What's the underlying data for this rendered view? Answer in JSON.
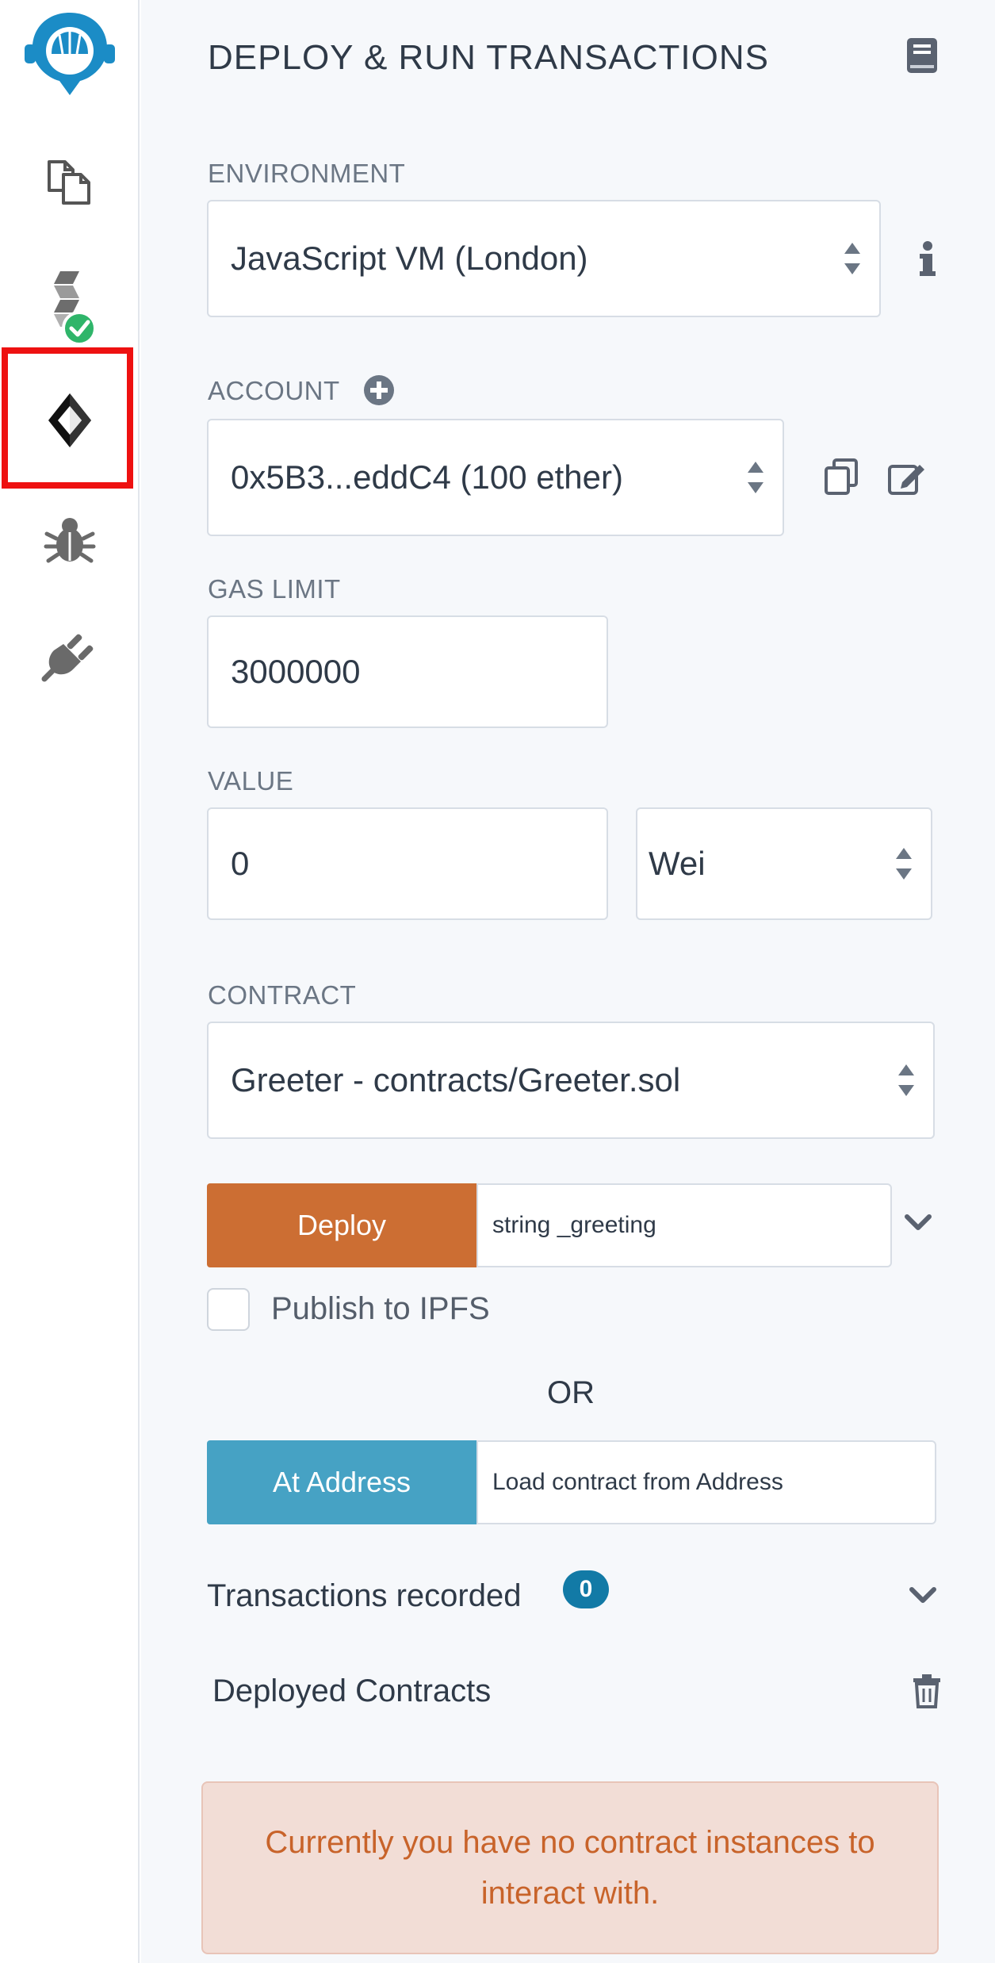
{
  "sidebar": {
    "items": [
      {
        "name": "remix-logo-icon"
      },
      {
        "name": "file-explorer-icon"
      },
      {
        "name": "solidity-compiler-icon"
      },
      {
        "name": "deploy-run-icon",
        "active": true
      },
      {
        "name": "debugger-icon"
      },
      {
        "name": "plugin-manager-icon"
      }
    ]
  },
  "panel": {
    "title": "DEPLOY & RUN TRANSACTIONS",
    "environment": {
      "label": "ENVIRONMENT",
      "value": "JavaScript VM (London)"
    },
    "account": {
      "label": "ACCOUNT",
      "value": "0x5B3...eddC4 (100 ether)"
    },
    "gas_limit": {
      "label": "GAS LIMIT",
      "value": "3000000"
    },
    "value": {
      "label": "VALUE",
      "amount": "0",
      "unit": "Wei"
    },
    "contract": {
      "label": "CONTRACT",
      "value": "Greeter - contracts/Greeter.sol"
    },
    "deploy": {
      "button": "Deploy",
      "param": "string _greeting"
    },
    "publish_ipfs": {
      "label": "Publish to IPFS",
      "checked": false
    },
    "or_text": "OR",
    "at_address": {
      "button": "At Address",
      "placeholder": "Load contract from Address"
    },
    "transactions": {
      "label": "Transactions recorded",
      "count": "0"
    },
    "deployed": {
      "label": "Deployed Contracts"
    },
    "alert": {
      "message": "Currently you have no contract instances to interact with."
    }
  },
  "colors": {
    "deploy_button": "#cc6e33",
    "at_address_button": "#46a2c4",
    "badge": "#127aa6",
    "active_frame": "#ee1111",
    "alert_bg": "#f2ddd6",
    "alert_text": "#c8632a"
  }
}
